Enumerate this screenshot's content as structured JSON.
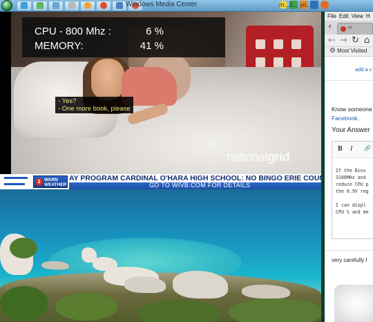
{
  "taskbar": {
    "window_title": "Windows Media Center",
    "tray_text": "m...1... yo..."
  },
  "overlay": {
    "cpu_label": "CPU - 800 Mhz :",
    "cpu_value": "6 %",
    "memory_label": "MEMORY:",
    "memory_value": "41 %"
  },
  "video": {
    "subtitle_line1": "- Yes?",
    "subtitle_line2": "- One more book, please",
    "watermark_light": "national",
    "watermark_bold": "grid"
  },
  "ticker": {
    "warn_line1": "WARN",
    "warn_line2": "WEATHER",
    "badge": "2",
    "headline": "AY PROGRAM     CARDINAL O'HARA HIGH SCHOOL: NO BINGO     ERIE COUN",
    "subline": "GO TO WIVB.COM FOR DETAILS"
  },
  "browser": {
    "menu": [
      "File",
      "Edit",
      "View",
      "H"
    ],
    "tab_title": "m",
    "bookmark_label": "Most Visited",
    "link_add_comment": "add a c",
    "text_know_someone": "Know someone",
    "link_facebook": "Facebook.",
    "heading_your_answer": "Your Answer",
    "editor_bold": "B",
    "editor_italic": "I",
    "editor_link": "🔗",
    "code_lines": [
      "If the Bios",
      "3100MHz and",
      "reduce CPU p",
      "the 0.9V reg",
      "",
      " I can displ",
      "CPU % and me"
    ],
    "text_very_carefully": "very carefully I"
  }
}
